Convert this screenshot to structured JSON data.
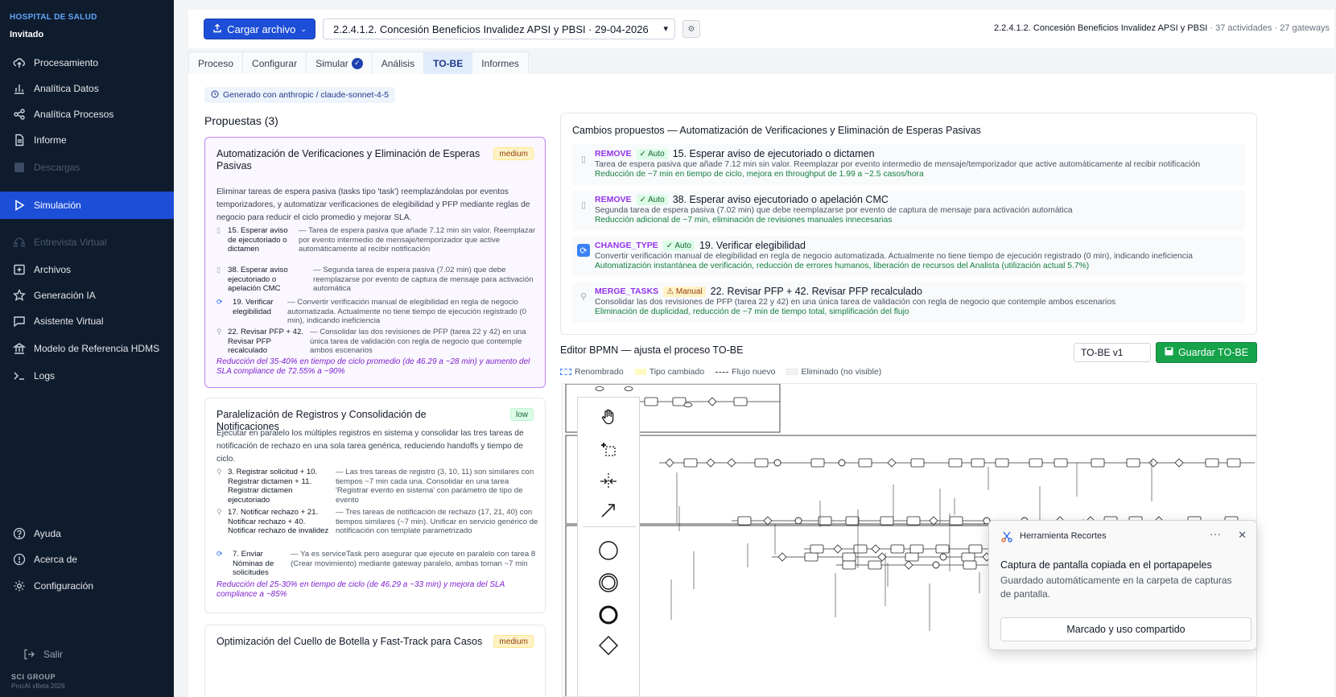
{
  "sidebar": {
    "brand": "HOSPITAL DE SALUD",
    "user": "Invitado",
    "items": [
      {
        "label": "Procesamiento"
      },
      {
        "label": "Analítica Datos"
      },
      {
        "label": "Analítica Procesos"
      },
      {
        "label": "Informe"
      },
      {
        "label": "Descargas"
      },
      {
        "label": "Simulación"
      },
      {
        "label": "Entrevista Virtual"
      },
      {
        "label": "Archivos"
      },
      {
        "label": "Generación IA"
      },
      {
        "label": "Asistente Virtual"
      },
      {
        "label": "Modelo de Referencia HDMS"
      },
      {
        "label": "Logs"
      }
    ],
    "bottom_items": [
      {
        "label": "Ayuda"
      },
      {
        "label": "Acerca de"
      },
      {
        "label": "Configuración"
      },
      {
        "label": "Salir"
      }
    ],
    "footer_company": "SCI GROUP",
    "footer_version": "ProcAI vBeta 2026"
  },
  "topbar": {
    "upload_label": "Cargar archivo",
    "process_select": "2.2.4.1.2. Concesión Beneficios Invalidez APSI y PBSI · 29-04-2026",
    "process_name": "2.2.4.1.2. Concesión Beneficios Invalidez APSI y PBSI",
    "activities": "· 37 actividades",
    "gateways": "· 27 gateways"
  },
  "tabs": [
    "Proceso",
    "Configurar",
    "Simular",
    "Análisis",
    "TO-BE",
    "Informes"
  ],
  "generated_badge": "Generado con anthropic / claude-sonnet-4-5",
  "proposals_title": "Propuestas (3)",
  "proposals": [
    {
      "title": "Automatización de Verificaciones y Eliminación de Esperas Pasivas",
      "priority": "medium",
      "description": "Eliminar tareas de espera pasiva (tasks tipo 'task') reemplazándolas por eventos temporizadores, y automatizar verificaciones de elegibilidad y PFP mediante reglas de negocio para reducir el ciclo promedio y mejorar SLA.",
      "changes": [
        {
          "task": "15. Esperar aviso de ejecutoriado o dictamen",
          "detail": "— Tarea de espera pasiva que añade 7.12 min sin valor. Reemplazar por evento intermedio de mensaje/temporizador que active automáticamente al recibir notificación"
        },
        {
          "task": "38. Esperar aviso ejecutoriado o apelación CMC",
          "detail": "— Segunda tarea de espera pasiva (7.02 min) que debe reemplazarse por evento de captura de mensaje para activación automática"
        },
        {
          "task": "19. Verificar elegibilidad",
          "detail": "— Convertir verificación manual de elegibilidad en regla de negocio automatizada. Actualmente no tiene tiempo de ejecución registrado (0 min), indicando ineficiencia"
        },
        {
          "task": "22. Revisar PFP + 42. Revisar PFP recalculado",
          "detail": "— Consolidar las dos revisiones de PFP (tarea 22 y 42) en una única tarea de validación con regla de negocio que contemple ambos escenarios"
        }
      ],
      "impact": "Reducción del 35-40% en tiempo de ciclo promedio (de 46.29 a ~28 min) y aumento del SLA compliance de 72.55% a ~90%"
    },
    {
      "title": "Paralelización de Registros y Consolidación de Notificaciones",
      "priority": "low",
      "description": "Ejecutar en paralelo los múltiples registros en sistema y consolidar las tres tareas de notificación de rechazo en una sola tarea genérica, reduciendo handoffs y tiempo de ciclo.",
      "changes": [
        {
          "task": "3. Registrar solicitud + 10. Registrar dictamen + 11. Registrar dictamen ejecutoriado",
          "detail": "— Las tres tareas de registro (3, 10, 11) son similares con tiempos ~7 min cada una. Consolidar en una tarea 'Registrar evento en sistema' con parámetro de tipo de evento"
        },
        {
          "task": "17. Notificar rechazo + 21. Notificar rechazo + 40. Notificar rechazo de invalidez",
          "detail": "— Tres tareas de notificación de rechazo (17, 21, 40) con tiempos similares (~7 min). Unificar en servicio genérico de notificación con template parametrizado"
        },
        {
          "task": "7. Enviar Nóminas de solicitudes",
          "detail": "— Ya es serviceTask pero asegurar que ejecute en paralelo con tarea 8 (Crear movimiento) mediante gateway paralelo, ambas toman ~7 min"
        }
      ],
      "impact": "Reducción del 25-30% en tiempo de ciclo (de 46.29 a ~33 min) y mejora del SLA compliance a ~85%"
    },
    {
      "title": "Optimización del Cuello de Botella y Fast-Track para Casos",
      "priority": "medium"
    }
  ],
  "changes_panel": {
    "title": "Cambios propuestos — Automatización de Verificaciones y Eliminación de Esperas Pasivas",
    "rows": [
      {
        "kind": "REMOVE",
        "mode": "✓ Auto",
        "title": "15. Esperar aviso de ejecutoriado o dictamen",
        "desc": "Tarea de espera pasiva que añade 7.12 min sin valor. Reemplazar por evento intermedio de mensaje/temporizador que active automáticamente al recibir notificación",
        "impact": "Reducción de ~7 min en tiempo de ciclo, mejora en throughput de 1.99 a ~2.5 casos/hora"
      },
      {
        "kind": "REMOVE",
        "mode": "✓ Auto",
        "title": "38. Esperar aviso ejecutoriado o apelación CMC",
        "desc": "Segunda tarea de espera pasiva (7.02 min) que debe reemplazarse por evento de captura de mensaje para activación automática",
        "impact": "Reducción adicional de ~7 min, eliminación de revisiones manuales innecesarias"
      },
      {
        "kind": "CHANGE_TYPE",
        "mode": "✓ Auto",
        "title": "19. Verificar elegibilidad",
        "desc": "Convertir verificación manual de elegibilidad en regla de negocio automatizada. Actualmente no tiene tiempo de ejecución registrado (0 min), indicando ineficiencia",
        "impact": "Automatización instantánea de verificación, reducción de errores humanos, liberación de recursos del Analista (utilización actual 5.7%)"
      },
      {
        "kind": "MERGE_TASKS",
        "mode": "⚠ Manual",
        "title": "22. Revisar PFP + 42. Revisar PFP recalculado",
        "desc": "Consolidar las dos revisiones de PFP (tarea 22 y 42) en una única tarea de validación con regla de negocio que contemple ambos escenarios",
        "impact": "Eliminación de duplicidad, reducción de ~7 min de tiempo total, simplificación del flujo"
      }
    ]
  },
  "editor": {
    "title": "Editor BPMN — ajusta el proceso TO-BE",
    "version_value": "TO-BE v1",
    "save_label": "Guardar TO-BE",
    "legend": [
      "Renombrado",
      "Tipo cambiado",
      "Flujo nuevo",
      "Eliminado (no visible)"
    ]
  },
  "toast": {
    "app": "Herramienta Recortes",
    "heading": "Captura de pantalla copiada en el portapapeles",
    "body": "Guardado automáticamente en la carpeta de capturas de pantalla.",
    "button": "Marcado y uso compartido"
  },
  "colors": {
    "sidebar_bg": "#0f1c2e",
    "accent": "#1d4ed8",
    "save_green": "#16a34a",
    "kind_purple": "#9333ea"
  }
}
